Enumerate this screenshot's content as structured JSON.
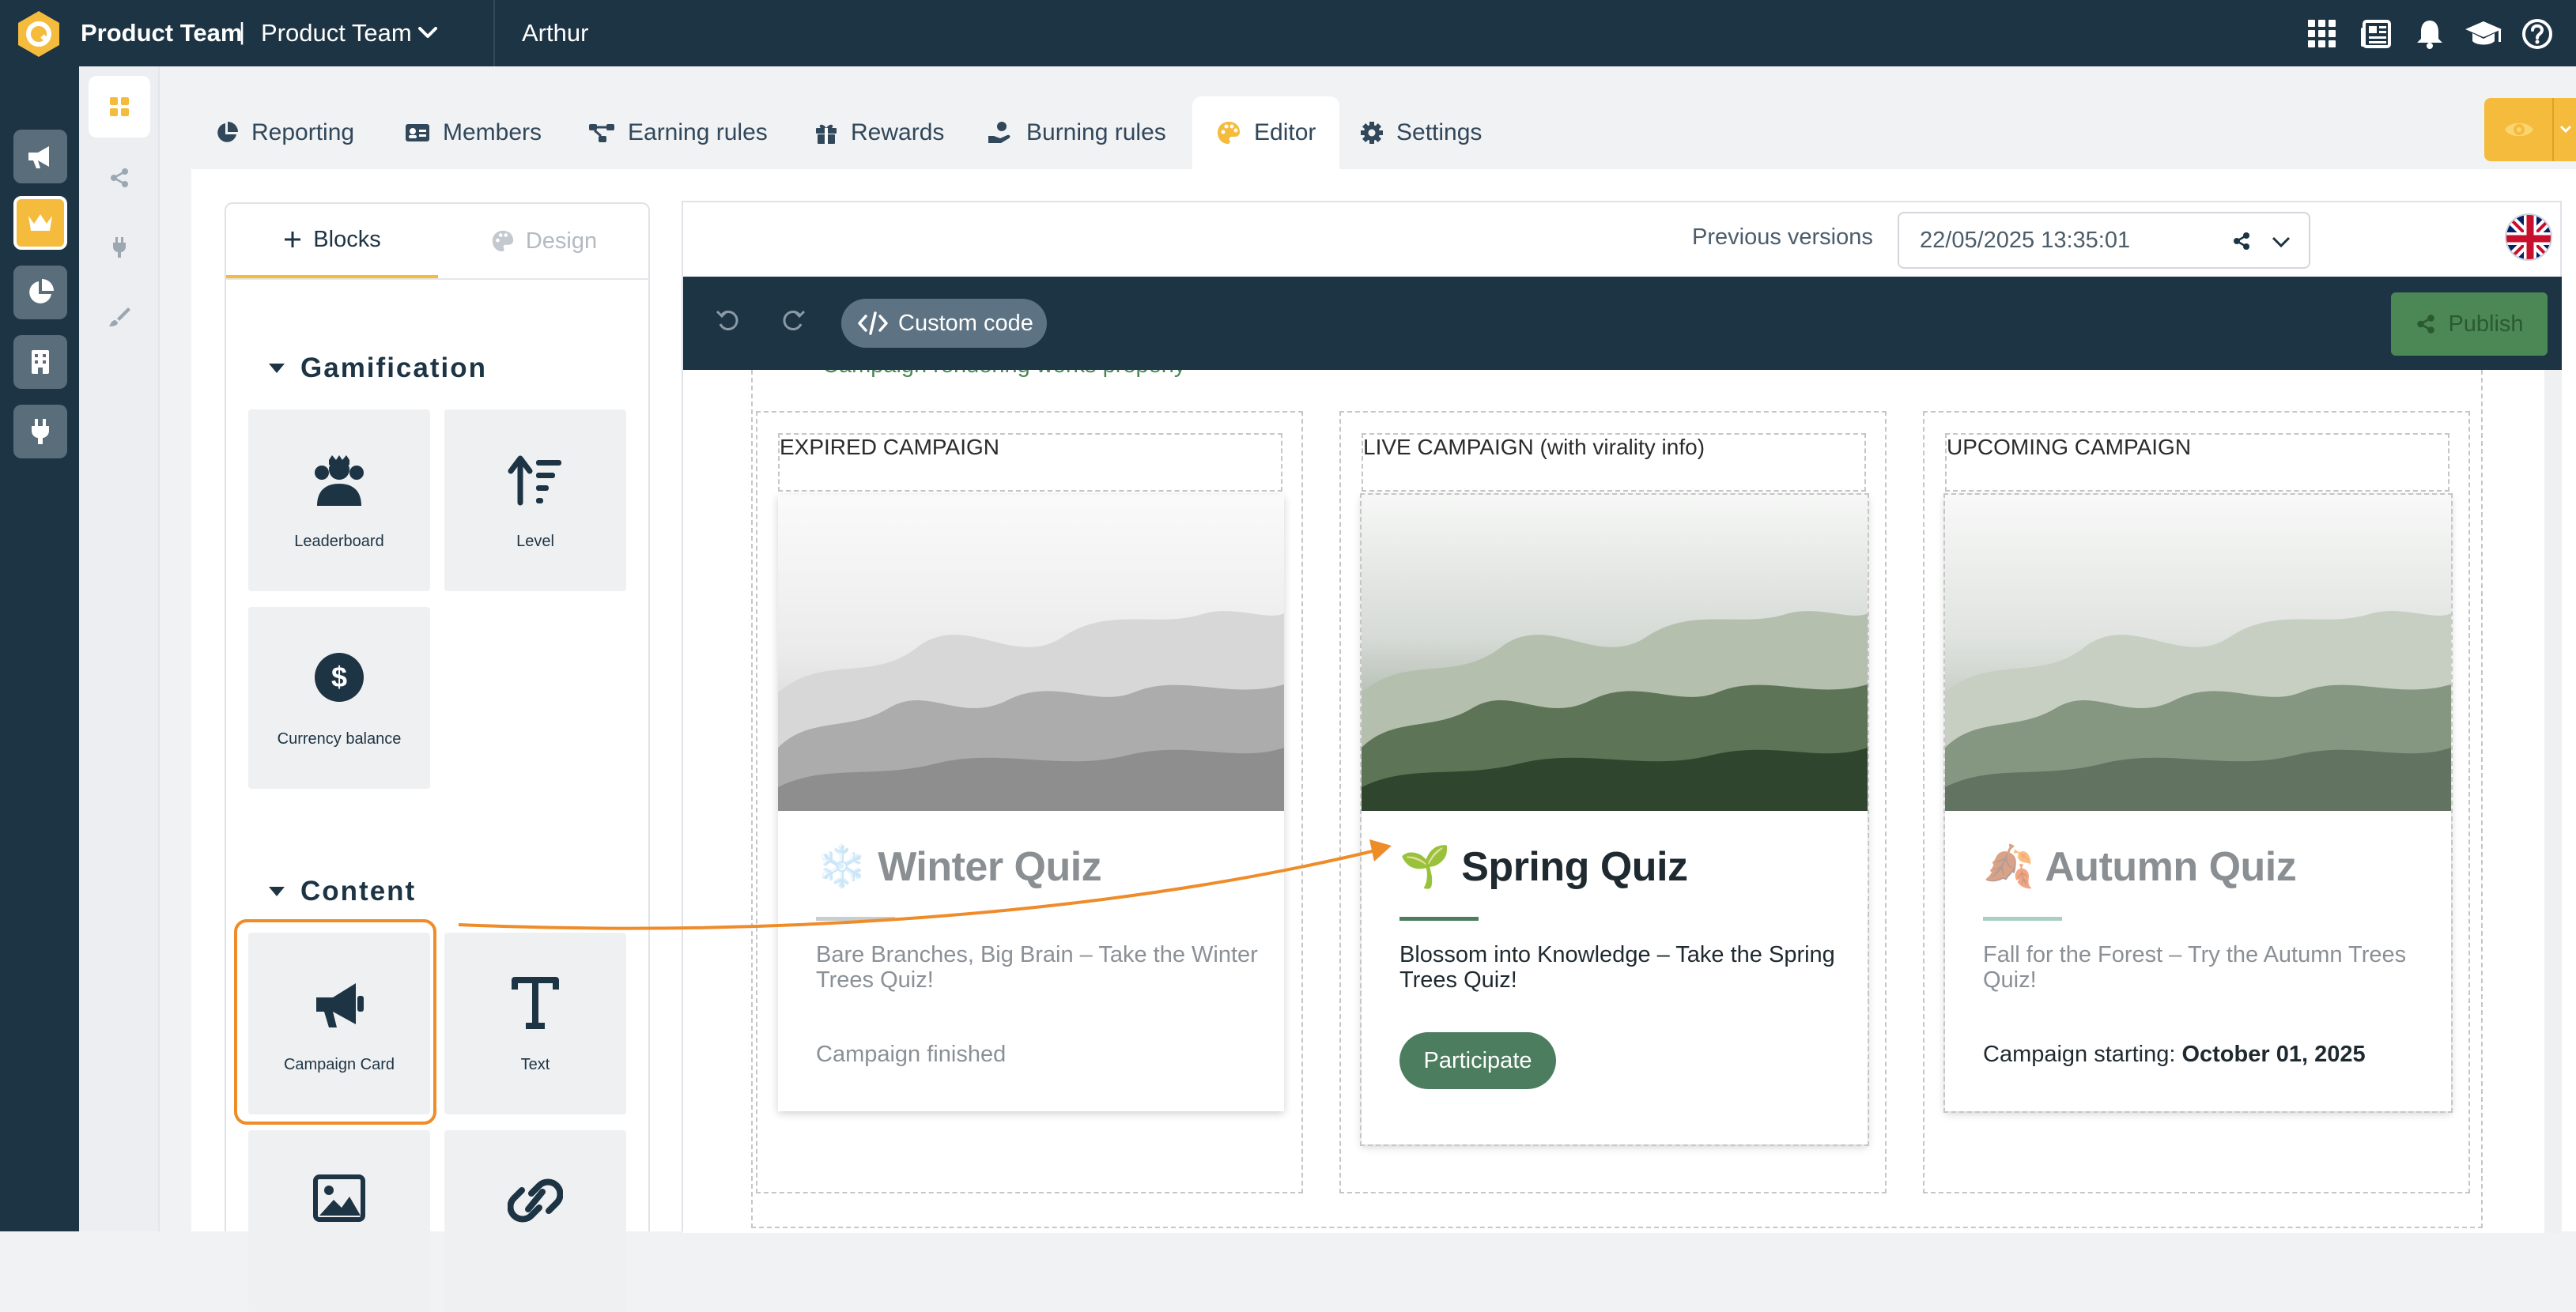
{
  "header": {
    "team_name": "Product Team",
    "separator": "|",
    "team_sub": "Product Team",
    "user": "Arthur",
    "icons": [
      "apps-grid-icon",
      "news-icon",
      "bell-icon",
      "graduation-cap-icon",
      "help-icon"
    ]
  },
  "left_rail": {
    "items": [
      "megaphone-icon",
      "crown-icon",
      "pie-chart-icon",
      "building-icon",
      "plug-icon"
    ],
    "active": "crown-icon"
  },
  "sub_rail": {
    "items": [
      "grid-icon",
      "share-icon",
      "plug-icon",
      "brush-icon"
    ],
    "active": "grid-icon"
  },
  "tabs": [
    {
      "label": "Reporting",
      "icon": "pie-chart-icon"
    },
    {
      "label": "Members",
      "icon": "id-card-icon"
    },
    {
      "label": "Earning rules",
      "icon": "nodes-icon"
    },
    {
      "label": "Rewards",
      "icon": "gift-icon"
    },
    {
      "label": "Burning rules",
      "icon": "hand-coin-icon"
    },
    {
      "label": "Editor",
      "icon": "palette-icon",
      "active": true
    },
    {
      "label": "Settings",
      "icon": "gear-icon"
    }
  ],
  "blocks_panel": {
    "tab_blocks": "Blocks",
    "tab_design": "Design",
    "sections": [
      {
        "title": "Gamification",
        "items": [
          "Leaderboard",
          "Level",
          "Currency balance"
        ]
      },
      {
        "title": "Content",
        "items": [
          "Campaign Card",
          "Text",
          "",
          ""
        ]
      }
    ]
  },
  "editor": {
    "previous_versions_label": "Previous versions",
    "version_value": "22/05/2025 13:35:01",
    "custom_code_label": "Custom code",
    "publish_label": "Publish",
    "cut_text": "Campaign rendering works properly",
    "columns": [
      {
        "heading": "EXPIRED CAMPAIGN",
        "title": "Winter Quiz",
        "emoji": "❄️",
        "description": "Bare Branches, Big Brain – Take the Winter Trees Quiz!",
        "status_text": "Campaign finished",
        "state": "expired"
      },
      {
        "heading": "LIVE CAMPAIGN (with virality info)",
        "title": "Spring Quiz",
        "emoji": "🌱",
        "description": "Blossom into Knowledge – Take the Spring Trees Quiz!",
        "button_label": "Participate",
        "state": "live"
      },
      {
        "heading": "UPCOMING CAMPAIGN",
        "title": "Autumn Quiz",
        "emoji": "🍂",
        "description": "Fall for the Forest – Try the Autumn Trees Quiz!",
        "status_prefix": "Campaign starting: ",
        "status_date": "October 01, 2025",
        "state": "upcoming"
      }
    ]
  },
  "colors": {
    "navy": "#1d3444",
    "accent_yellow": "#f4bb3c",
    "highlight_orange": "#ef8c2a",
    "success_green": "#4c7d5e"
  }
}
